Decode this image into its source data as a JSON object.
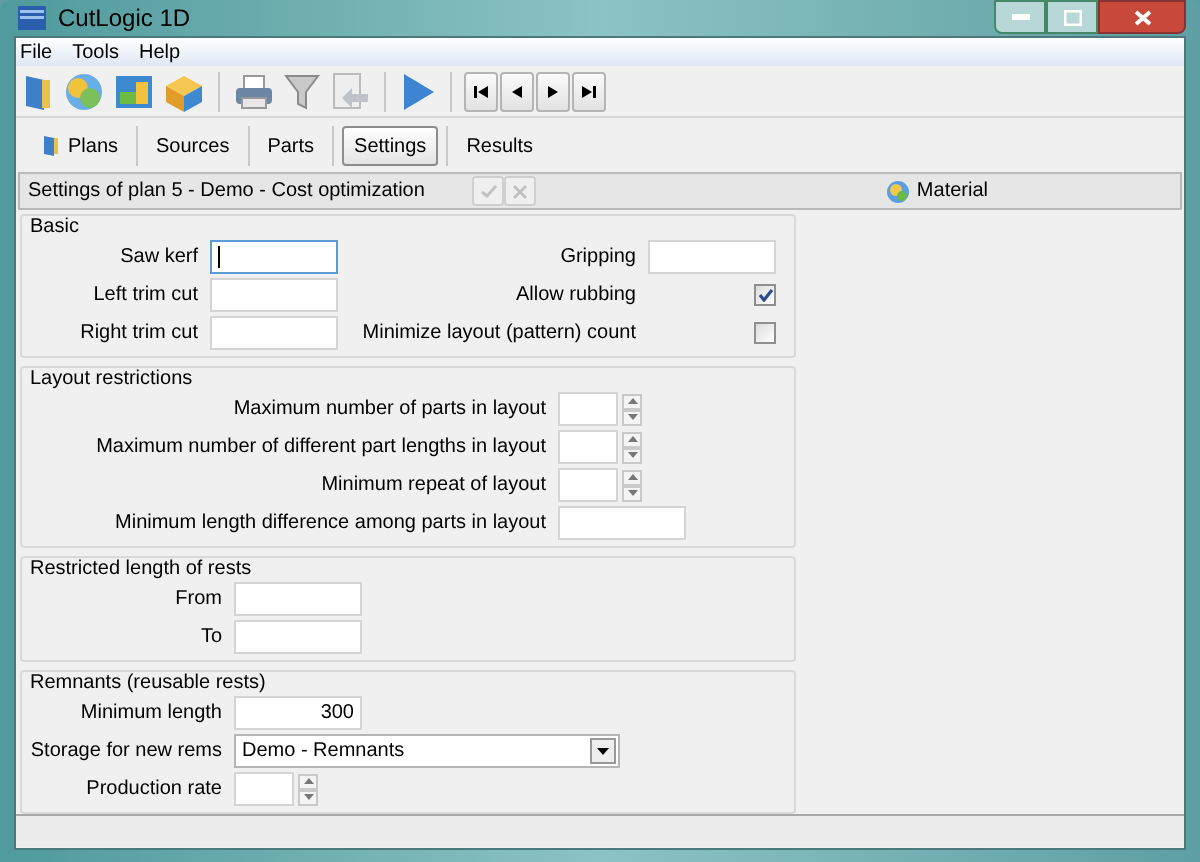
{
  "window": {
    "title": "CutLogic 1D"
  },
  "menu": [
    "File",
    "Tools",
    "Help"
  ],
  "tabs": [
    {
      "label": "Plans",
      "selected": false,
      "icon": true
    },
    {
      "label": "Sources",
      "selected": false,
      "icon": false
    },
    {
      "label": "Parts",
      "selected": false,
      "icon": false
    },
    {
      "label": "Settings",
      "selected": true,
      "icon": false
    },
    {
      "label": "Results",
      "selected": false,
      "icon": false
    }
  ],
  "header": {
    "title": "Settings of plan 5 - Demo - Cost optimization",
    "material_button": "Material"
  },
  "sections": [
    {
      "title": "Basic",
      "kind": "paired",
      "columns": [
        [
          {
            "kind": "text",
            "label": "Saw kerf",
            "focused": true
          },
          {
            "kind": "text",
            "label": "Left trim cut",
            "focused": false
          },
          {
            "kind": "text",
            "label": "Right trim cut",
            "focused": false
          }
        ],
        [
          {
            "kind": "text",
            "label": "Gripping",
            "focused": false
          },
          {
            "kind": "checkbox",
            "label": "Allow rubbing",
            "checked": true
          },
          {
            "kind": "checkbox",
            "label": "Minimize layout (pattern) count",
            "checked": false
          }
        ]
      ]
    },
    {
      "title": "Layout restrictions",
      "kind": "wide",
      "columns": [
        [
          {
            "kind": "spinner",
            "label": "Maximum number of parts in layout"
          },
          {
            "kind": "spinner",
            "label": "Maximum number of different part lengths in layout"
          },
          {
            "kind": "spinner",
            "label": "Minimum repeat of layout"
          },
          {
            "kind": "text",
            "label": "Minimum length difference among parts in layout",
            "focused": false
          }
        ]
      ]
    },
    {
      "title": "Restricted length of rests",
      "kind": "narrow",
      "columns": [
        [
          {
            "kind": "text",
            "label": "From",
            "focused": false
          },
          {
            "kind": "text",
            "label": "To",
            "focused": false
          }
        ]
      ]
    },
    {
      "title": "Remnants (reusable rests)",
      "kind": "narrow",
      "columns": [
        [
          {
            "kind": "text",
            "label": "Minimum length",
            "value": "300",
            "focused": false
          },
          {
            "kind": "dropdown",
            "label": "Storage for new rems",
            "value": "Demo - Remnants"
          },
          {
            "kind": "spinner",
            "label": "Production rate"
          }
        ]
      ]
    }
  ]
}
